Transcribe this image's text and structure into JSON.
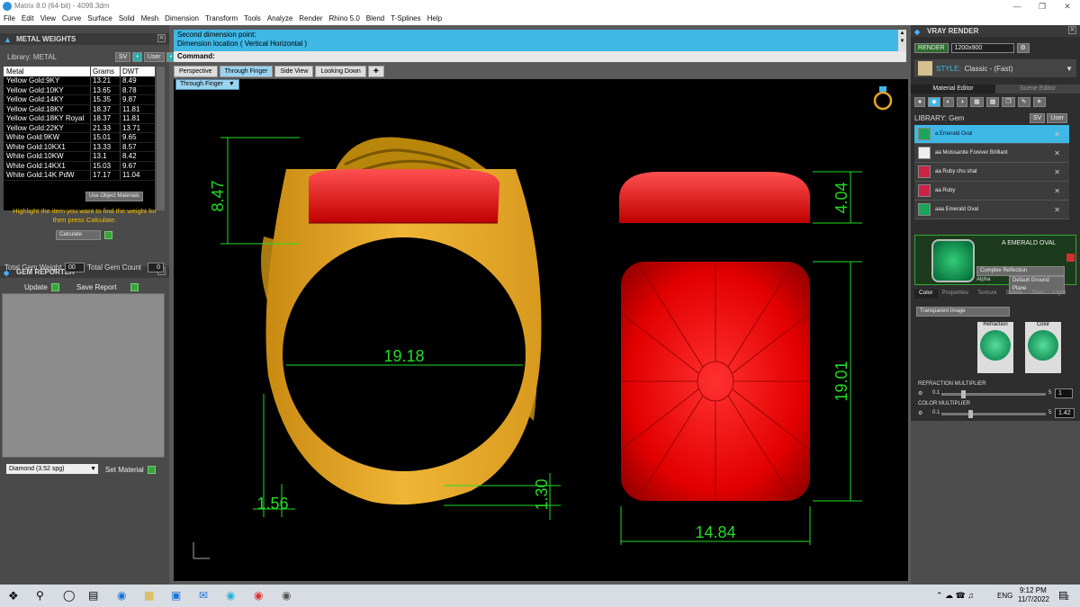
{
  "app": {
    "title": "Matrix 8.0 (64-bit) - 4099.3dm"
  },
  "menu": [
    "File",
    "Edit",
    "View",
    "Curve",
    "Surface",
    "Solid",
    "Mesh",
    "Dimension",
    "Transform",
    "Tools",
    "Analyze",
    "Render",
    "Rhino 5.0",
    "Blend",
    "T-Splines",
    "Help"
  ],
  "metal_weights": {
    "title": "METAL WEIGHTS",
    "library_label": "Library: METAL",
    "sv": "SV",
    "user": "User",
    "columns": [
      "Metal",
      "Grams",
      "DWT"
    ],
    "rows": [
      [
        "Yellow Gold:9KY",
        "13.21",
        "8.49"
      ],
      [
        "Yellow Gold:10KY",
        "13.65",
        "8.78"
      ],
      [
        "Yellow Gold:14KY",
        "15.35",
        "9.87"
      ],
      [
        "Yellow Gold:18KY",
        "18.37",
        "11.81"
      ],
      [
        "Yellow Gold:18KY Royal",
        "18.37",
        "11.81"
      ],
      [
        "Yellow Gold:22KY",
        "21.33",
        "13.71"
      ],
      [
        "White Gold:9KW",
        "15.01",
        "9.65"
      ],
      [
        "White Gold:10KX1",
        "13.33",
        "8.57"
      ],
      [
        "White Gold:10KW",
        "13.1",
        "8.42"
      ],
      [
        "White Gold:14KX1",
        "15.03",
        "9.67"
      ],
      [
        "White Gold:14K PdW",
        "17.17",
        "11.04"
      ]
    ],
    "use_object_materials": "Use Object Materials",
    "hint": "Highlight the item you want to find the weight for then press Calculate.",
    "calculate": "Calculate"
  },
  "gem_reporter": {
    "title": "GEM REPORTER",
    "total_weight_label": "Total Gem Weight",
    "total_weight": "00",
    "total_count_label": "Total Gem Count",
    "total_count": "0",
    "update": "Update",
    "save_report": "Save Report",
    "material_select": "Diamond    (3.52 spg)",
    "set_material": "Set Material"
  },
  "command": {
    "line1": "Second dimension point:",
    "line2": "Dimension location ( Vertical  Horizontal )",
    "prompt": "Command:"
  },
  "tabs": [
    "Perspective",
    "Through Finger",
    "Side View",
    "Looking Down"
  ],
  "active_tab": 1,
  "view_selector": "Through Finger",
  "dimensions": {
    "ring_top": "8.47",
    "ring_inner": "19.18",
    "shank_bottom": "1.30",
    "shank_side": "1.56",
    "stone_side": "4.04",
    "stone_length": "19.01",
    "stone_width": "14.84"
  },
  "vray": {
    "title": "VRAY RENDER",
    "render": "RENDER",
    "resolution": "1200x900",
    "style_label": "STYLE:",
    "style": "Classic - (Fast)",
    "tabs": [
      "Material Editor",
      "Scene Editor"
    ],
    "library": "LIBRARY: Gem",
    "sv": "SV",
    "user": "User",
    "gems": [
      {
        "name": "a Emerald Oval",
        "color": "#1aa55a"
      },
      {
        "name": "aa Moissanite Forever Brilliant",
        "color": "#eeeeee"
      },
      {
        "name": "aa Ruby chu shat",
        "color": "#cc2244"
      },
      {
        "name": "aa Ruby",
        "color": "#cc2244"
      },
      {
        "name": "aaa Emerald Oval",
        "color": "#1aa55a"
      }
    ],
    "preview_name": "A EMERALD OVAL",
    "complex": "Complex Reflection",
    "alpha": "Alpha",
    "ground": "Default Ground Plane",
    "subtabs": [
      "Color",
      "Properties",
      "Texture",
      "Scene",
      "Toon",
      "Light"
    ],
    "transparent": "Transparent Image",
    "refraction": "Refraction",
    "color": "Color",
    "refraction_mult_label": "REFRACTION MULTIPLIER",
    "refraction_min": "0.1",
    "refraction_max": "5",
    "refraction_value": "1",
    "color_mult_label": "COLOR MULTIPLIER",
    "color_min": "0.1",
    "color_max": "5",
    "color_value": "1.42"
  },
  "taskbar": {
    "lang": "ENG",
    "time": "9:12 PM",
    "date": "11/7/2022",
    "notif": "2"
  },
  "colors": {
    "accent": "#3fb8e6",
    "gold": "#e8a72a",
    "ruby": "#e01010",
    "dim": "#22dd22"
  }
}
